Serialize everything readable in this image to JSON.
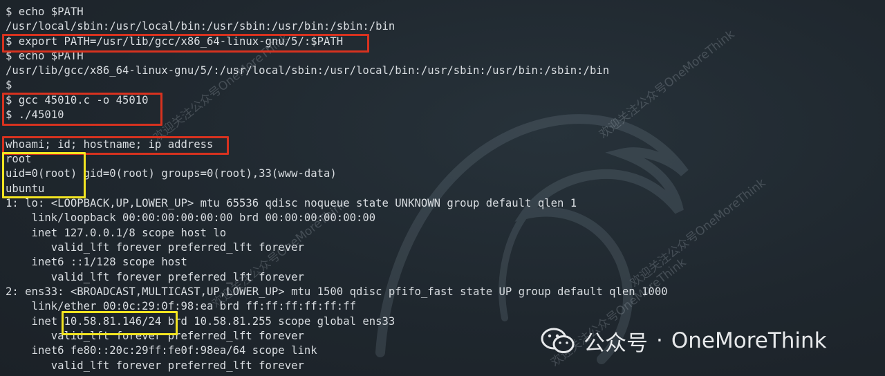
{
  "terminal": {
    "lines": [
      "$ echo $PATH",
      "/usr/local/sbin:/usr/local/bin:/usr/sbin:/usr/bin:/sbin:/bin",
      "$ export PATH=/usr/lib/gcc/x86_64-linux-gnu/5/:$PATH",
      "$ echo $PATH",
      "/usr/lib/gcc/x86_64-linux-gnu/5/:/usr/local/sbin:/usr/local/bin:/usr/sbin:/usr/bin:/sbin:/bin",
      "$",
      "$ gcc 45010.c -o 45010",
      "$ ./45010",
      "",
      "whoami; id; hostname; ip address",
      "root",
      "uid=0(root) gid=0(root) groups=0(root),33(www-data)",
      "ubuntu",
      "1: lo: <LOOPBACK,UP,LOWER_UP> mtu 65536 qdisc noqueue state UNKNOWN group default qlen 1",
      "    link/loopback 00:00:00:00:00:00 brd 00:00:00:00:00:00",
      "    inet 127.0.0.1/8 scope host lo",
      "       valid_lft forever preferred_lft forever",
      "    inet6 ::1/128 scope host",
      "       valid_lft forever preferred_lft forever",
      "2: ens33: <BROADCAST,MULTICAST,UP,LOWER_UP> mtu 1500 qdisc pfifo_fast state UP group default qlen 1000",
      "    link/ether 00:0c:29:0f:98:ea brd ff:ff:ff:ff:ff:ff",
      "    inet 10.58.81.146/24 brd 10.58.81.255 scope global ens33",
      "       valid_lft forever preferred_lft forever",
      "    inet6 fe80::20c:29ff:fe0f:98ea/64 scope link",
      "       valid_lft forever preferred_lft forever"
    ]
  },
  "watermark": {
    "text": "欢迎关注公众号OneMoreThink"
  },
  "badge": {
    "account_label": "公众号",
    "separator": "·",
    "account_name": "OneMoreThink"
  },
  "colors": {
    "background": "#1f262d",
    "text": "#d9dde1",
    "highlight_red": "#d8321f",
    "highlight_yellow": "#f2e421"
  },
  "icons": {
    "logo": "kali-dragon-icon",
    "badge": "wechat-icon"
  }
}
